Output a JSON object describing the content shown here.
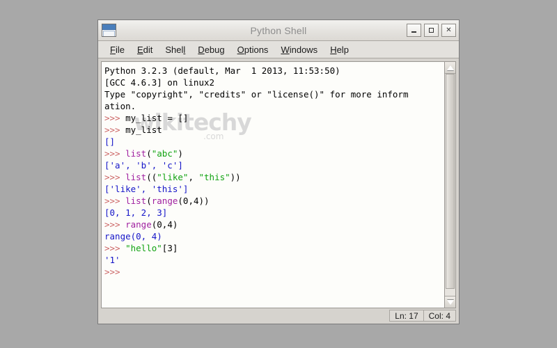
{
  "window": {
    "title": "Python Shell",
    "icon": "window-icon",
    "controls": [
      {
        "name": "minimize",
        "glyph": "minimize-icon"
      },
      {
        "name": "maximize",
        "glyph": "maximize-icon"
      },
      {
        "name": "close",
        "label": "✕"
      }
    ]
  },
  "menubar": {
    "items": [
      {
        "pre": "",
        "mnemonic": "F",
        "post": "ile"
      },
      {
        "pre": "",
        "mnemonic": "E",
        "post": "dit"
      },
      {
        "pre": "Shel",
        "mnemonic": "l",
        "post": ""
      },
      {
        "pre": "",
        "mnemonic": "D",
        "post": "ebug"
      },
      {
        "pre": "",
        "mnemonic": "O",
        "post": "ptions"
      },
      {
        "pre": "",
        "mnemonic": "W",
        "post": "indows"
      },
      {
        "pre": "",
        "mnemonic": "H",
        "post": "elp"
      }
    ]
  },
  "watermark": {
    "main": "wikitechy",
    "sub": ".com"
  },
  "console": {
    "lines": [
      [
        {
          "t": "Python 3.2.3 (default, Mar  1 2013, 11:53:50)",
          "c": "plain"
        }
      ],
      [
        {
          "t": "[GCC 4.6.3] on linux2",
          "c": "plain"
        }
      ],
      [
        {
          "t": "Type \"copyright\", \"credits\" or \"license()\" for more inform",
          "c": "plain"
        }
      ],
      [
        {
          "t": "ation.",
          "c": "plain"
        }
      ],
      [
        {
          "t": ">>> ",
          "c": "prompt"
        },
        {
          "t": "my_list = []",
          "c": "plain"
        }
      ],
      [
        {
          "t": ">>> ",
          "c": "prompt"
        },
        {
          "t": "my_list",
          "c": "plain"
        }
      ],
      [
        {
          "t": "[]",
          "c": "out"
        }
      ],
      [
        {
          "t": ">>> ",
          "c": "prompt"
        },
        {
          "t": "list",
          "c": "builtin"
        },
        {
          "t": "(",
          "c": "plain"
        },
        {
          "t": "\"abc\"",
          "c": "str"
        },
        {
          "t": ")",
          "c": "plain"
        }
      ],
      [
        {
          "t": "['a', 'b', 'c']",
          "c": "out"
        }
      ],
      [
        {
          "t": ">>> ",
          "c": "prompt"
        },
        {
          "t": "list",
          "c": "builtin"
        },
        {
          "t": "((",
          "c": "plain"
        },
        {
          "t": "\"like\"",
          "c": "str"
        },
        {
          "t": ", ",
          "c": "plain"
        },
        {
          "t": "\"this\"",
          "c": "str"
        },
        {
          "t": "))",
          "c": "plain"
        }
      ],
      [
        {
          "t": "['like', 'this']",
          "c": "out"
        }
      ],
      [
        {
          "t": ">>> ",
          "c": "prompt"
        },
        {
          "t": "list",
          "c": "builtin"
        },
        {
          "t": "(",
          "c": "plain"
        },
        {
          "t": "range",
          "c": "builtin"
        },
        {
          "t": "(0,4))",
          "c": "plain"
        }
      ],
      [
        {
          "t": "[0, 1, 2, 3]",
          "c": "out"
        }
      ],
      [
        {
          "t": ">>> ",
          "c": "prompt"
        },
        {
          "t": "range",
          "c": "builtin"
        },
        {
          "t": "(0,4)",
          "c": "plain"
        }
      ],
      [
        {
          "t": "range(0, 4)",
          "c": "out"
        }
      ],
      [
        {
          "t": ">>> ",
          "c": "prompt"
        },
        {
          "t": "\"hello\"",
          "c": "str"
        },
        {
          "t": "[3]",
          "c": "plain"
        }
      ],
      [
        {
          "t": "'1'",
          "c": "out"
        }
      ],
      [
        {
          "t": ">>> ",
          "c": "prompt"
        }
      ]
    ]
  },
  "statusbar": {
    "line": "Ln: 17",
    "col": "Col: 4"
  },
  "colors": {
    "prompt": "#cc6666",
    "output": "#1414c8",
    "string": "#12a312",
    "builtin": "#a020a0",
    "desktop": "#a8a8a8",
    "chrome": "#d6d3ce"
  }
}
